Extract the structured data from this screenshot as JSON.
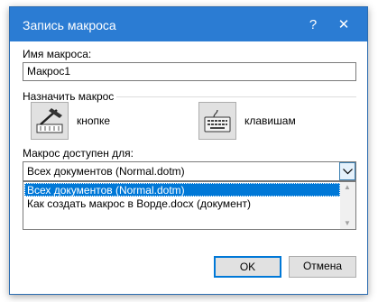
{
  "window": {
    "title": "Запись макроса",
    "help_label": "?",
    "close_label": "✕"
  },
  "macro_name": {
    "label": "Имя макроса:",
    "value": "Макрос1"
  },
  "assign": {
    "label": "Назначить макрос",
    "button_label": "кнопке",
    "keyboard_label": "клавишам"
  },
  "store": {
    "label": "Макрос доступен для:",
    "selected": "Всех документов (Normal.dotm)",
    "options": [
      "Всех документов (Normal.dotm)",
      "Как создать макрос в Ворде.docx (документ)"
    ]
  },
  "buttons": {
    "ok": "OK",
    "cancel": "Отмена"
  },
  "colors": {
    "titlebar": "#2b7cd3",
    "selection": "#0078d7"
  },
  "icons": {
    "button_icon": "hammer-toolbar-icon",
    "keyboard_icon": "keyboard-icon"
  }
}
